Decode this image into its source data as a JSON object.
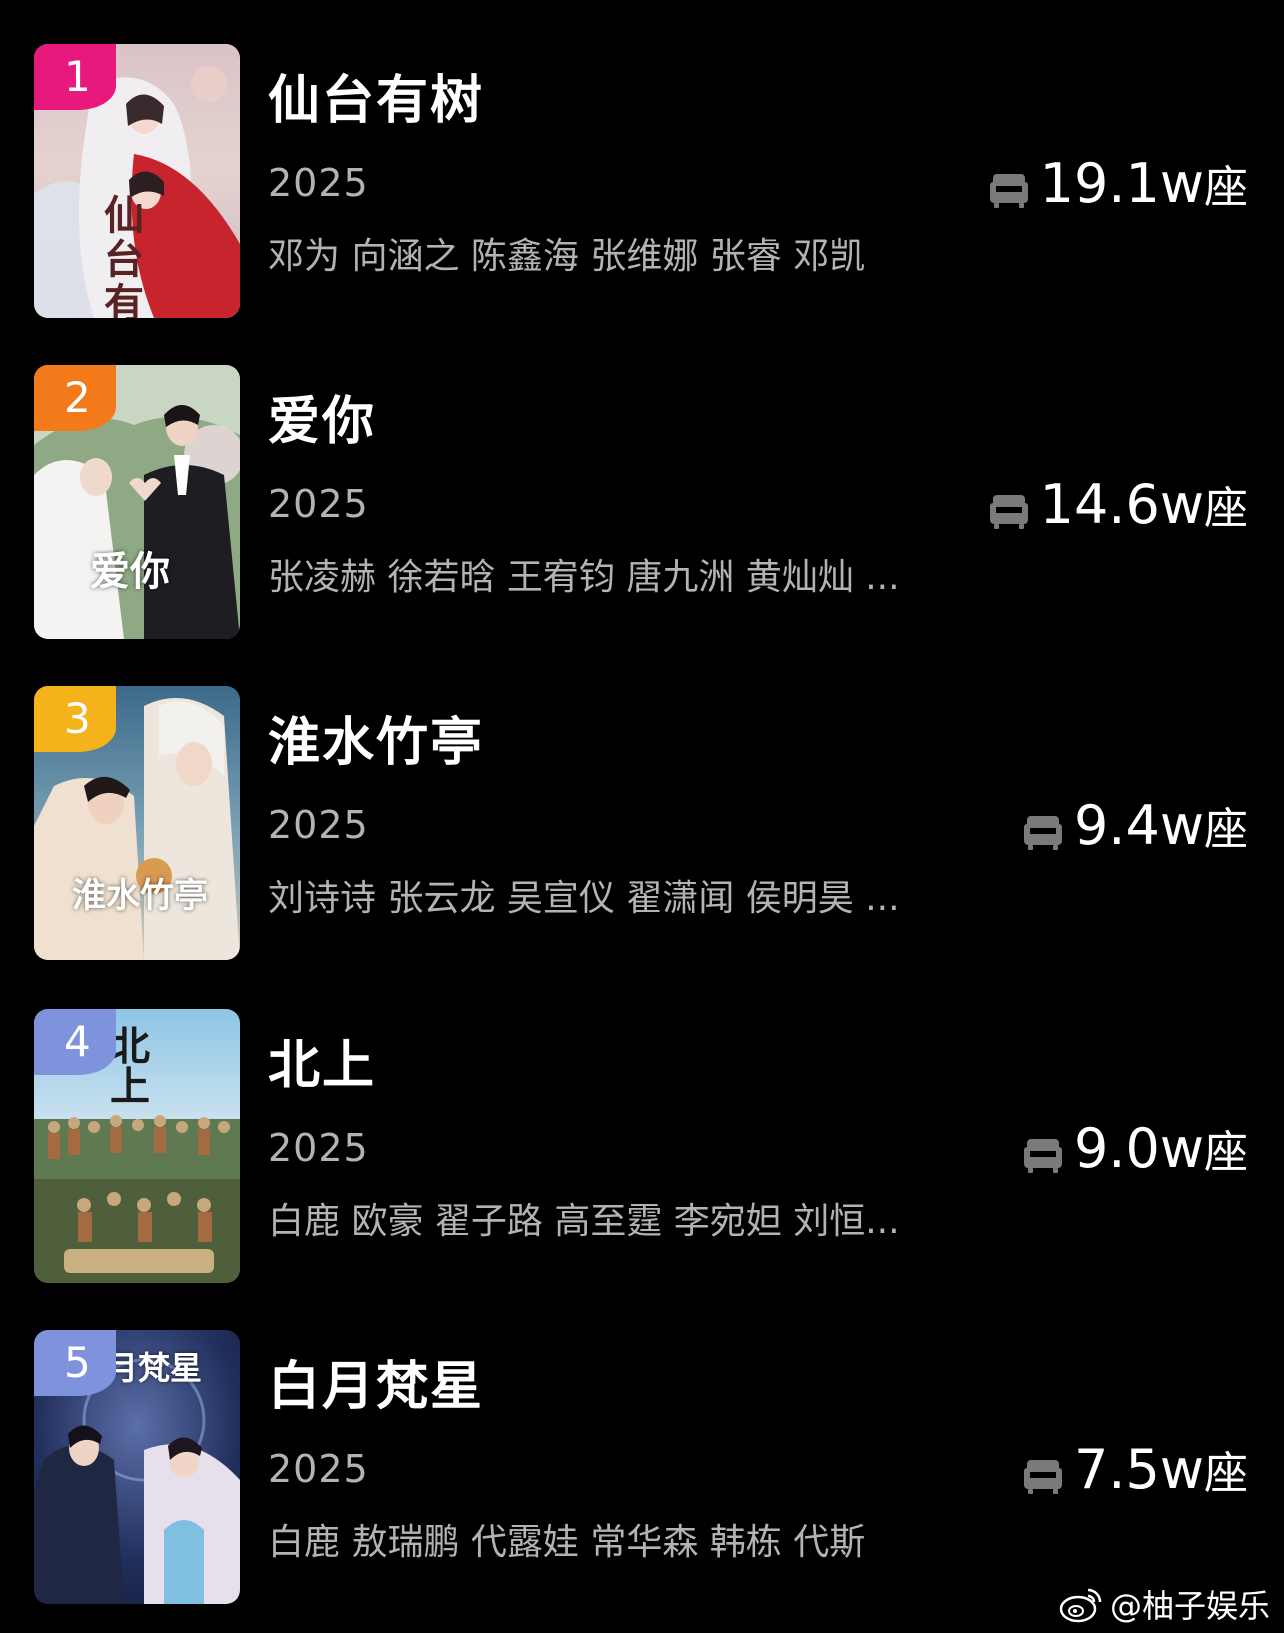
{
  "colors": {
    "background": "#000000",
    "title": "#ffffff",
    "subtext": "#b3b3b3",
    "rank_1": "#e8197d",
    "rank_2": "#f27a1a",
    "rank_3": "#f4b21b",
    "rank_4_5": "#7f93dc"
  },
  "seat_icon": "armchair-icon",
  "items": [
    {
      "rank": "1",
      "title": "仙台有树",
      "year": "2025",
      "cast": "邓为 向涵之 陈鑫海 张维娜 张睿 邓凯",
      "seats": "19.1w",
      "unit": "座",
      "poster_text": "仙台有树"
    },
    {
      "rank": "2",
      "title": "爱你",
      "year": "2025",
      "cast": "张凌赫 徐若晗 王宥钧 唐九洲 黄灿灿 ...",
      "seats": "14.6w",
      "unit": "座",
      "poster_text": "爱你"
    },
    {
      "rank": "3",
      "title": "淮水竹亭",
      "year": "2025",
      "cast": "刘诗诗 张云龙 吴宣仪 翟潇闻 侯明昊 ...",
      "seats": "9.4w",
      "unit": "座",
      "poster_text": "淮水竹亭"
    },
    {
      "rank": "4",
      "title": "北上",
      "year": "2025",
      "cast": "白鹿 欧豪 翟子路 高至霆 李宛妲 刘恒...",
      "seats": "9.0w",
      "unit": "座",
      "poster_text": "北上"
    },
    {
      "rank": "5",
      "title": "白月梵星",
      "year": "2025",
      "cast": "白鹿 敖瑞鹏 代露娃 常华森 韩栋 代斯",
      "seats": "7.5w",
      "unit": "座",
      "poster_text": "月梵星"
    }
  ],
  "watermark": {
    "icon": "weibo-icon",
    "text": "@柚子娱乐"
  }
}
